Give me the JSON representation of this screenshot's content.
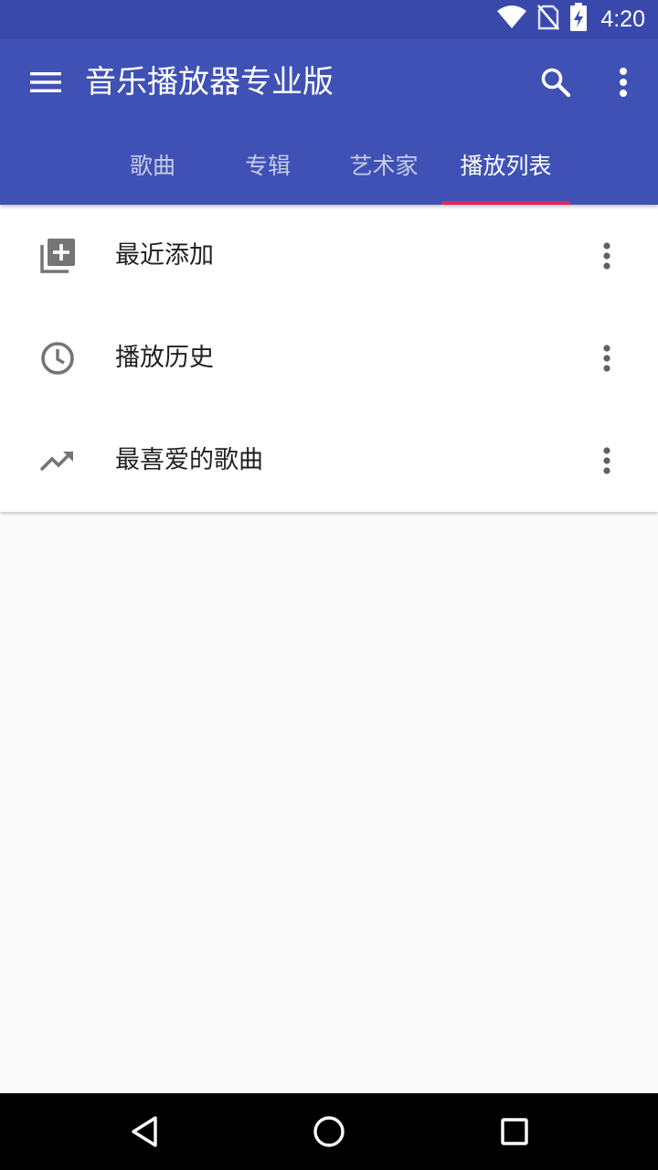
{
  "status_bar": {
    "time": "4:20",
    "icons": [
      "wifi-icon",
      "no-sim-icon",
      "battery-charging-icon"
    ]
  },
  "app_bar": {
    "title": "音乐播放器专业版",
    "icons": {
      "menu": "menu-icon",
      "search": "search-icon",
      "overflow": "more-vert-icon"
    }
  },
  "tabs": [
    {
      "label": "歌曲",
      "active": false
    },
    {
      "label": "专辑",
      "active": false
    },
    {
      "label": "艺术家",
      "active": false
    },
    {
      "label": "播放列表",
      "active": true
    }
  ],
  "playlists": [
    {
      "label": "最近添加",
      "icon": "library-add-icon"
    },
    {
      "label": "播放历史",
      "icon": "clock-icon"
    },
    {
      "label": "最喜爱的歌曲",
      "icon": "trending-up-icon"
    }
  ],
  "colors": {
    "status_bar": "#3949ab",
    "primary": "#3f51b5",
    "accent": "#e91e63",
    "icon_gray": "#757575"
  },
  "nav_bar": {
    "icons": [
      "back-icon",
      "home-icon",
      "recents-icon"
    ]
  }
}
